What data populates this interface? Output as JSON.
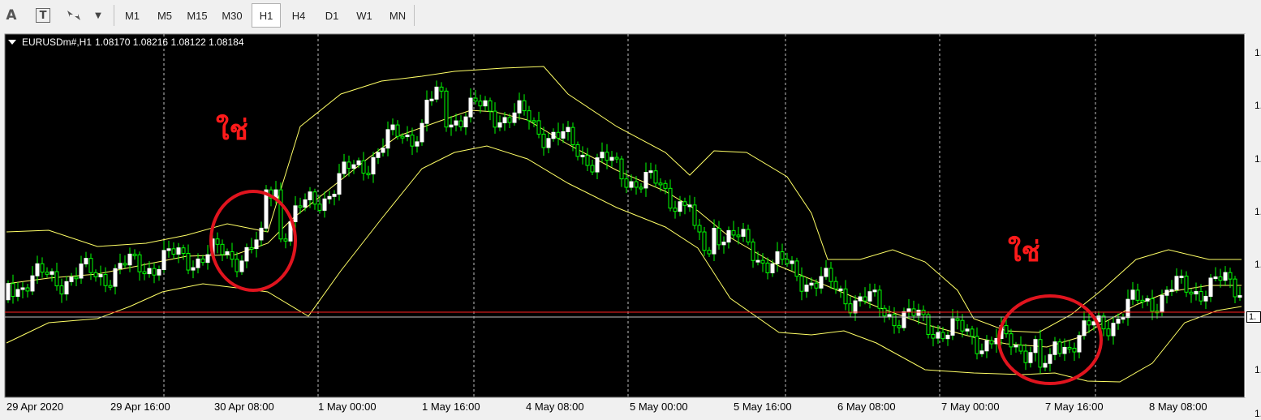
{
  "toolbar": {
    "text_tool_glyph": "A",
    "label_tool_glyph": "T",
    "icons": [
      "text-tool-icon",
      "text-label-icon",
      "arrows-icon",
      "dropdown-icon"
    ],
    "timeframes": [
      "M1",
      "M5",
      "M15",
      "M30",
      "H1",
      "H4",
      "D1",
      "W1",
      "MN"
    ],
    "active_timeframe": "H1"
  },
  "chart": {
    "symbol": "EURUSDm#,H1",
    "ohlc": "1.08170 1.08216 1.08122 1.08184",
    "annotations": [
      "ใช่",
      "ใช่"
    ],
    "price_axis_labels": [
      "1.",
      "1.",
      "1.",
      "1.",
      "1.",
      "1.",
      "1.",
      "1."
    ],
    "bid_label": "1.",
    "time_labels": [
      "29 Apr 2020",
      "29 Apr 16:00",
      "30 Apr 08:00",
      "1 May 00:00",
      "1 May 16:00",
      "4 May 08:00",
      "5 May 00:00",
      "5 May 16:00",
      "6 May 08:00",
      "7 May 00:00",
      "7 May 16:00",
      "8 May 08:00"
    ],
    "colors": {
      "background": "#000000",
      "candle_bull": "#ffffff",
      "candle_bear": "#00ff00",
      "wick": "#00ff00",
      "bollinger": "#ffff66",
      "bid_line": "#ff2020",
      "grid": "#bfbfbf",
      "circle": "#e0141e"
    }
  }
}
